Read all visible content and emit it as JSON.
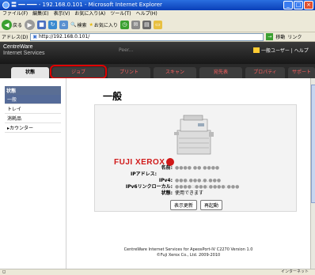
{
  "window": {
    "title": "〓 ━━ ━━━ - 192.168.0.101 - Microsoft Internet Explorer"
  },
  "menu": [
    "ファイル(F)",
    "編集(E)",
    "表示(V)",
    "お気に入り(A)",
    "ツール(T)",
    "ヘルプ(H)"
  ],
  "toolbar": {
    "back": "戻る",
    "search": "検索",
    "favorites": "お気に入り"
  },
  "address": {
    "label": "アドレス(D)",
    "url": "http://192.168.0.101/",
    "go": "移動",
    "links": "リンク"
  },
  "header": {
    "brand_line1": "CentreWare",
    "brand_line2": "Internet Services",
    "host": "Peer...",
    "user": "一般ユーザー | ヘルプ"
  },
  "tabs": [
    "状態",
    "ジョブ",
    "プリント",
    "スキャン",
    "宛先表",
    "プロパティ",
    "サポート"
  ],
  "nav": {
    "heading": "状態",
    "items": [
      "一般",
      "トレイ",
      "消耗品",
      "▸カウンター"
    ]
  },
  "main": {
    "title": "一般",
    "info": [
      {
        "k": "名前:",
        "v": "●●●● ●● ●●●●",
        "plain": false
      },
      {
        "k": "IPアドレス:",
        "v": "",
        "plain": false
      },
      {
        "k": "IPv4:",
        "v": "●●●.●●●.●.●●●",
        "plain": false
      },
      {
        "k": "IPv6リンクローカル:",
        "v": "●●●●::●●●:●●●●:●●●",
        "plain": false
      },
      {
        "k": "状態:",
        "v": "使用できます",
        "plain": true
      }
    ],
    "refresh_label": "表示更新",
    "restart_label": "再起動"
  },
  "brand": {
    "logo": "FUJI XEROX"
  },
  "footer": {
    "line1": "CentreWare Internet Services for ApeosPort-IV C2270 Version 1.0",
    "line2": "©Fuji Xerox Co., Ltd. 2009-2010"
  },
  "status": {
    "zone": "インターネット"
  },
  "colors": {
    "accent": "#d01818",
    "highlight": "#e00000",
    "nav": "#556b99"
  }
}
